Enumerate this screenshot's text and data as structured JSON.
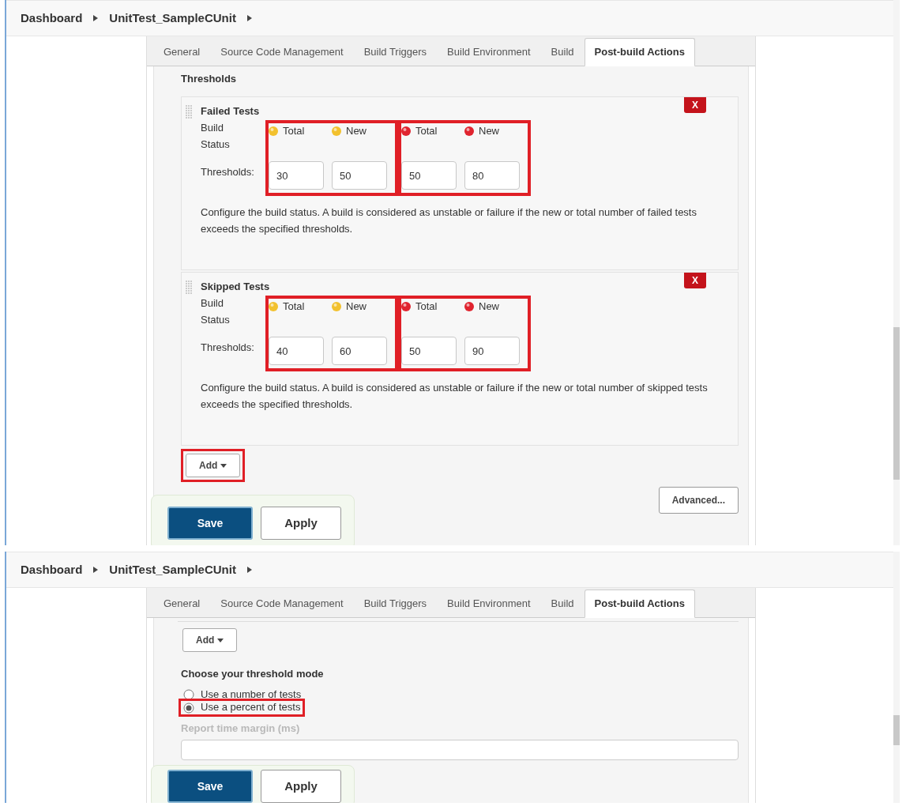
{
  "panels": [
    {
      "kind": "thresholds",
      "breadcrumb": [
        {
          "label": "Dashboard"
        },
        {
          "label": "UnitTest_SampleCUnit"
        }
      ],
      "tabs": [
        {
          "label": "General",
          "selected": false
        },
        {
          "label": "Source Code Management",
          "selected": false
        },
        {
          "label": "Build Triggers",
          "selected": false
        },
        {
          "label": "Build Environment",
          "selected": false
        },
        {
          "label": "Build",
          "selected": false
        },
        {
          "label": "Post-build Actions",
          "selected": true
        }
      ],
      "section_title": "Thresholds",
      "groups": [
        {
          "title": "Failed Tests",
          "delete_label": "X",
          "status_label": "Build Status",
          "thresholds_label": "Thresholds:",
          "highlighted": true,
          "columns": [
            {
              "label": "Total",
              "color": "#f2c12e",
              "value": "30"
            },
            {
              "label": "New",
              "color": "#f2c12e",
              "value": "50"
            },
            {
              "label": "Total",
              "color": "#e0242f",
              "value": "50"
            },
            {
              "label": "New",
              "color": "#e0242f",
              "value": "80"
            }
          ],
          "description": "Configure the build status. A build is considered as unstable or failure if the new or total number of failed tests exceeds the specified thresholds."
        },
        {
          "title": "Skipped Tests",
          "delete_label": "X",
          "status_label": "Build Status",
          "thresholds_label": "Thresholds:",
          "highlighted": true,
          "columns": [
            {
              "label": "Total",
              "color": "#f2c12e",
              "value": "40"
            },
            {
              "label": "New",
              "color": "#f2c12e",
              "value": "60"
            },
            {
              "label": "Total",
              "color": "#e0242f",
              "value": "50"
            },
            {
              "label": "New",
              "color": "#e0242f",
              "value": "90"
            }
          ],
          "description": "Configure the build status. A build is considered as unstable or failure if the new or total number of skipped tests exceeds the specified thresholds."
        }
      ],
      "add_button": {
        "label": "Add",
        "highlighted": true
      },
      "advanced_button": {
        "label": "Advanced..."
      },
      "save_label": "Save",
      "apply_label": "Apply"
    },
    {
      "kind": "mode",
      "breadcrumb": [
        {
          "label": "Dashboard"
        },
        {
          "label": "UnitTest_SampleCUnit"
        }
      ],
      "tabs": [
        {
          "label": "General",
          "selected": false
        },
        {
          "label": "Source Code Management",
          "selected": false
        },
        {
          "label": "Build Triggers",
          "selected": false
        },
        {
          "label": "Build Environment",
          "selected": false
        },
        {
          "label": "Build",
          "selected": false
        },
        {
          "label": "Post-build Actions",
          "selected": true
        }
      ],
      "add_button": {
        "label": "Add",
        "highlighted": false
      },
      "mode_title": "Choose your threshold mode",
      "modes": [
        {
          "label": "Use a number of tests",
          "selected": false,
          "highlighted": false
        },
        {
          "label": "Use a percent of tests",
          "selected": true,
          "highlighted": true
        }
      ],
      "margin_label": "Report time margin (ms)",
      "save_label": "Save",
      "apply_label": "Apply"
    }
  ]
}
